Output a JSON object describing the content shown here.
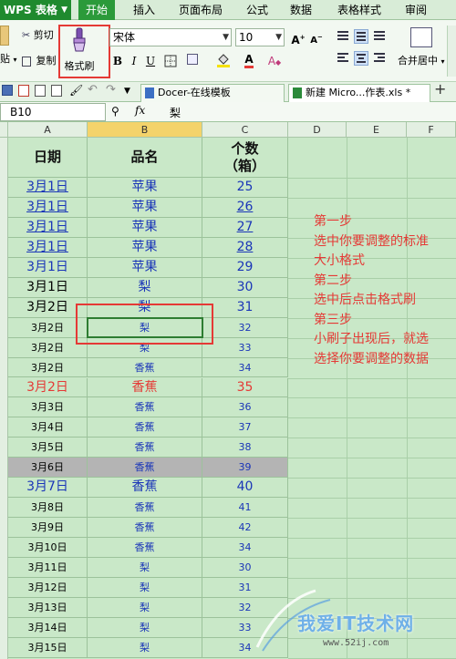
{
  "app": {
    "title": "WPS 表格"
  },
  "menu": [
    "开始",
    "插入",
    "页面布局",
    "公式",
    "数据",
    "表格样式",
    "审阅"
  ],
  "ribbon": {
    "cut_label": "剪切",
    "copy_label": "复制",
    "paste_label": "贴",
    "format_painter_label": "格式刷",
    "font_name": "宋体",
    "font_size": "10",
    "bold": "B",
    "italic": "I",
    "underline": "U",
    "merge_label": "合并居中"
  },
  "tabs": [
    {
      "label": "Docer-在线模板"
    },
    {
      "label": "新建 Micro...作表.xls *"
    }
  ],
  "formula_bar": {
    "cell_ref": "B10",
    "fx": "fx",
    "value": "梨"
  },
  "columns": [
    "A",
    "B",
    "C",
    "D",
    "E",
    "F"
  ],
  "table": {
    "headers": {
      "date": "日期",
      "name": "品名",
      "count_line1": "个数",
      "count_line2": "（箱）"
    },
    "rows": [
      {
        "date": "3月1日",
        "name": "苹果",
        "count": "25"
      },
      {
        "date": "3月1日",
        "name": "苹果",
        "count": "26"
      },
      {
        "date": "3月1日",
        "name": "苹果",
        "count": "27"
      },
      {
        "date": "3月1日",
        "name": "苹果",
        "count": "28"
      },
      {
        "date": "3月1日",
        "name": "苹果",
        "count": "29"
      },
      {
        "date": "3月1日",
        "name": "梨",
        "count": "30"
      },
      {
        "date": "3月2日",
        "name": "梨",
        "count": "31"
      },
      {
        "date": "3月2日",
        "name": "梨",
        "count": "32"
      },
      {
        "date": "3月2日",
        "name": "梨",
        "count": "33"
      },
      {
        "date": "3月2日",
        "name": "香蕉",
        "count": "34"
      },
      {
        "date": "3月2日",
        "name": "香蕉",
        "count": "35"
      },
      {
        "date": "3月3日",
        "name": "香蕉",
        "count": "36"
      },
      {
        "date": "3月4日",
        "name": "香蕉",
        "count": "37"
      },
      {
        "date": "3月5日",
        "name": "香蕉",
        "count": "38"
      },
      {
        "date": "3月6日",
        "name": "香蕉",
        "count": "39"
      },
      {
        "date": "3月7日",
        "name": "香蕉",
        "count": "40"
      },
      {
        "date": "3月8日",
        "name": "香蕉",
        "count": "41"
      },
      {
        "date": "3月9日",
        "name": "香蕉",
        "count": "42"
      },
      {
        "date": "3月10日",
        "name": "香蕉",
        "count": "34"
      },
      {
        "date": "3月11日",
        "name": "梨",
        "count": "30"
      },
      {
        "date": "3月12日",
        "name": "梨",
        "count": "31"
      },
      {
        "date": "3月13日",
        "name": "梨",
        "count": "32"
      },
      {
        "date": "3月14日",
        "name": "梨",
        "count": "33"
      },
      {
        "date": "3月15日",
        "name": "梨",
        "count": "34"
      }
    ]
  },
  "instructions": [
    "第一步",
    "选中你要调整的标准",
    "大小格式",
    "第二步",
    "选中后点击格式刷",
    "第三步",
    "小刷子出现后，就选",
    "选择你要调整的数据"
  ],
  "watermark": {
    "text": "我爱IT技术网",
    "url": "www.52ij.com"
  },
  "colors": {
    "accent_green": "#1f8a2e",
    "highlight_red": "#e53935",
    "link_blue": "#1a35b8",
    "sheet_bg": "#c9e8c8"
  }
}
